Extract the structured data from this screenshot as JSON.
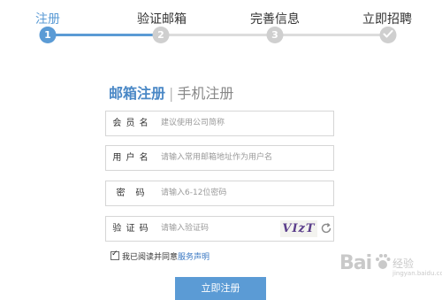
{
  "steps": [
    {
      "label": "注册",
      "number": "1",
      "state": "active"
    },
    {
      "label": "验证邮箱",
      "number": "2",
      "state": "pending"
    },
    {
      "label": "完善信息",
      "number": "3",
      "state": "pending"
    },
    {
      "label": "立即招聘",
      "number": "",
      "icon": "check-icon",
      "state": "pending"
    }
  ],
  "tabs": {
    "email": "邮箱注册",
    "separator": "|",
    "phone": "手机注册"
  },
  "form": {
    "member_name": {
      "label": "会 员 名",
      "placeholder": "建议使用公司简称"
    },
    "username": {
      "label": "用 户 名",
      "placeholder": "请输入常用邮箱地址作为用户名"
    },
    "password": {
      "label": "密　码",
      "placeholder": "请输入6-12位密码"
    },
    "captcha": {
      "label": "验 证 码",
      "placeholder": "请输入验证码",
      "code": "VIzT",
      "refresh_icon": "refresh-icon"
    }
  },
  "agreement": {
    "text": "我已阅读并同意",
    "link": "服务声明",
    "checked": true
  },
  "submit_label": "立即注册",
  "watermark": {
    "brand": "Bai",
    "sub": "经验",
    "url": "jingyan.baidu.com"
  },
  "colors": {
    "accent": "#5b9bd5",
    "inactive": "#cfcfcf",
    "link": "#3a78c3"
  }
}
